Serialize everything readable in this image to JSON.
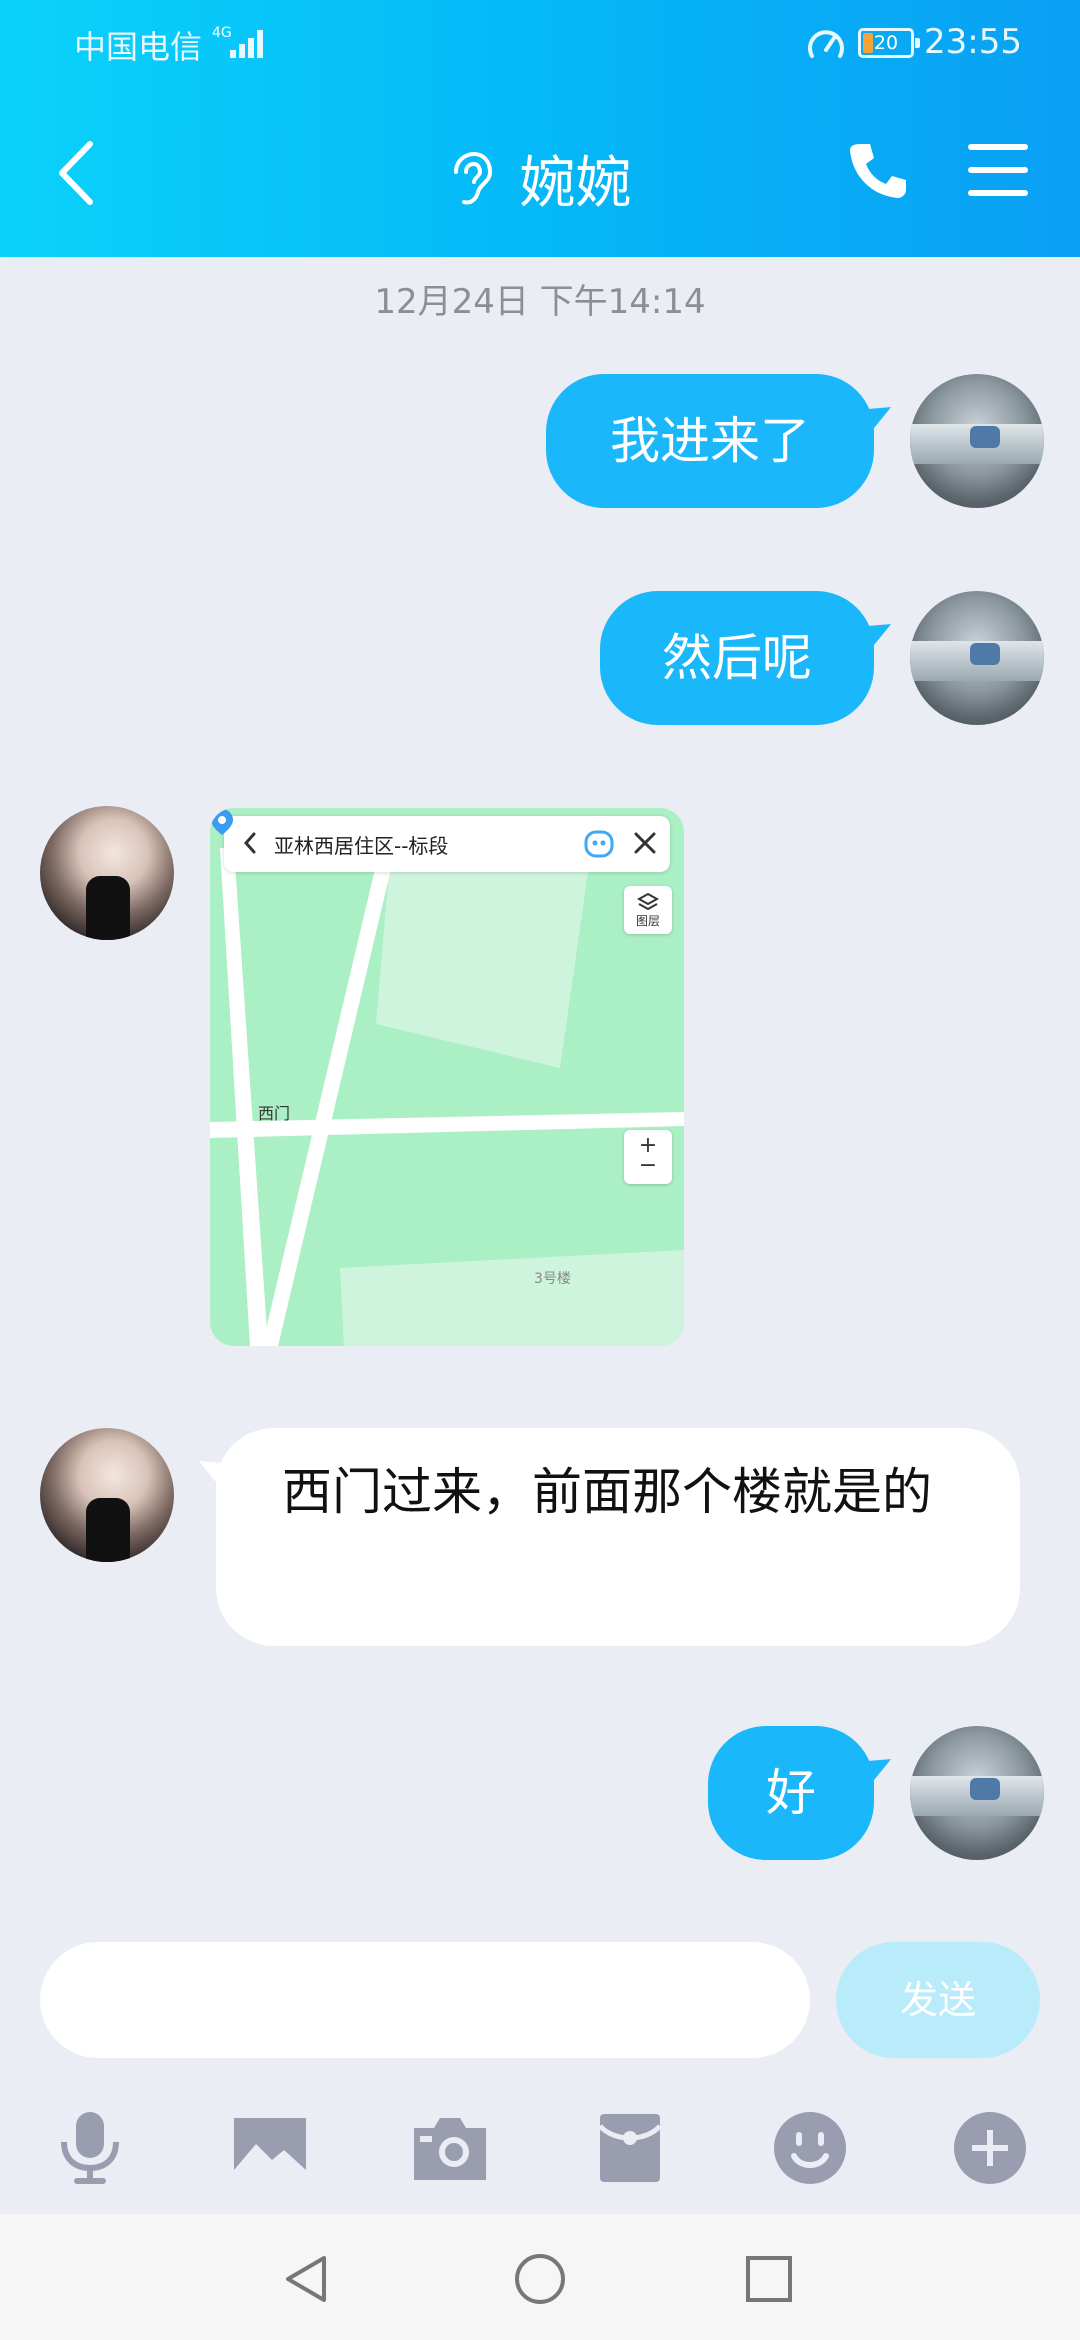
{
  "status_bar": {
    "carrier": "中国电信",
    "network": "4G",
    "battery": "20",
    "time": "23:55"
  },
  "header": {
    "title": "婉婉",
    "back_icon": "chevron-left-icon",
    "ear_icon": "ear-icon",
    "call_icon": "phone-icon",
    "menu_icon": "menu-icon"
  },
  "conversation": {
    "timestamp": "12月24日 下午14:14",
    "messages": [
      {
        "from": "me",
        "type": "text",
        "text": "我进来了"
      },
      {
        "from": "me",
        "type": "text",
        "text": "然后呢"
      },
      {
        "from": "her",
        "type": "location",
        "map": {
          "title": "亚林西居住区--标段",
          "layer_label": "图层",
          "zoom_in": "+",
          "zoom_out": "−",
          "poi": "西门",
          "building": "3号楼"
        }
      },
      {
        "from": "her",
        "type": "text",
        "text": "西门过来，前面那个楼就是的"
      },
      {
        "from": "me",
        "type": "text",
        "text": "好"
      }
    ]
  },
  "composer": {
    "input_value": "",
    "send_label": "发送"
  },
  "toolbar": {
    "icons": [
      "microphone-icon",
      "image-icon",
      "camera-icon",
      "red-packet-icon",
      "emoji-icon",
      "plus-icon"
    ]
  },
  "system_nav": {
    "icons": [
      "back-triangle-icon",
      "home-circle-icon",
      "recents-square-icon"
    ]
  },
  "colors": {
    "header_gradient_start": "#0ad2fb",
    "header_gradient_end": "#0aa0f4",
    "outgoing_bubble": "#1ab7fa",
    "incoming_bubble": "#ffffff",
    "background": "#eaedf4",
    "send_button_disabled": "#b9ecfb",
    "icon_gray": "#9a9cb0"
  }
}
